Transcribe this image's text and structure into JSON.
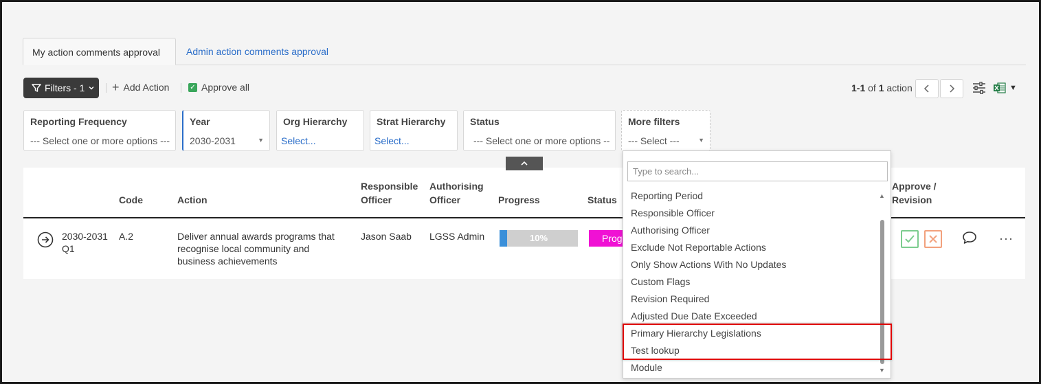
{
  "tabs": [
    {
      "label": "My action comments approval",
      "active": true
    },
    {
      "label": "Admin action comments approval",
      "active": false
    }
  ],
  "toolbar": {
    "filters_label": "Filters - 1",
    "add_action_label": "Add Action",
    "approve_all_label": "Approve all",
    "pager_range": "1-1",
    "pager_of": "of",
    "pager_total": "1",
    "pager_unit": "action",
    "prev_icon": "chevron-left-icon",
    "next_icon": "chevron-right-icon"
  },
  "filters": [
    {
      "label": "Reporting Frequency",
      "value": "--- Select one or more options ---"
    },
    {
      "label": "Year",
      "value": "2030-2031"
    },
    {
      "label": "Org Hierarchy",
      "value": "Select..."
    },
    {
      "label": "Strat Hierarchy",
      "value": "Select..."
    },
    {
      "label": "Status",
      "value": "--- Select one or more options ---"
    },
    {
      "label": "More filters",
      "value": "--- Select ---"
    }
  ],
  "table": {
    "headers": {
      "code": "Code",
      "action": "Action",
      "responsible_line1": "Responsible",
      "responsible_line2": "Officer",
      "authorising_line1": "Authorising",
      "authorising_line2": "Officer",
      "progress": "Progress",
      "status": "Status",
      "approve_line1": "Approve /",
      "approve_line2": "Revision"
    },
    "row": {
      "period_line1": "2030-2031",
      "period_line2": "Q1",
      "code": "A.2",
      "action_line1": "Deliver annual awards programs that",
      "action_line2": "recognise local community and",
      "action_line3": "business achievements",
      "responsible": "Jason Saab",
      "authorising": "LGSS Admin",
      "progress_pct": 10,
      "progress_text": "10%",
      "status_text": "Progress",
      "status_color": "#f011d4"
    }
  },
  "dropdown": {
    "search_placeholder": "Type to search...",
    "items": [
      "Reporting Period",
      "Responsible Officer",
      "Authorising Officer",
      "Exclude Not Reportable Actions",
      "Only Show Actions With No Updates",
      "Custom Flags",
      "Revision Required",
      "Adjusted Due Date Exceeded",
      "Primary Hierarchy Legislations",
      "Test lookup",
      "Module"
    ]
  },
  "colors": {
    "accent_link": "#2a6dc9",
    "dark_button": "#3a3a3a",
    "highlight_box": "#e00000",
    "progress_fill": "#3a8fd9"
  }
}
